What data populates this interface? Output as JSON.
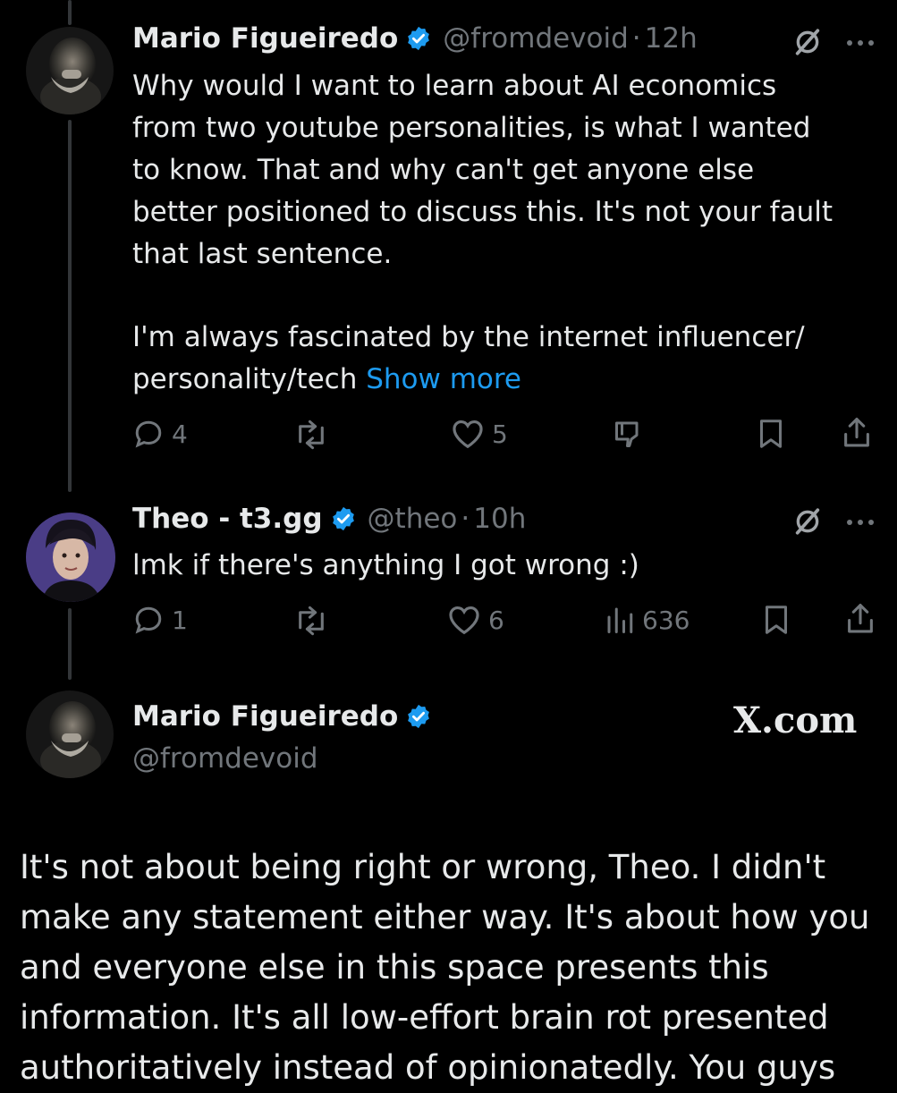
{
  "tweet1": {
    "name": "Mario Figueiredo",
    "handle": "@fromdevoid",
    "time": "12h",
    "text_main": "Why would I want to learn about AI economics\nfrom two youtube personalities, is what I wanted\nto know. That and why can't get anyone else\nbetter positioned to discuss this. It's not your fault\nthat last sentence.",
    "text_second": "I'm always fascinated by the internet influencer/\npersonality/tech ",
    "show_more": "Show more",
    "replies": "4",
    "likes": "5"
  },
  "tweet2": {
    "name": "Theo - t3.gg",
    "handle": "@theo",
    "time": "10h",
    "text": "lmk if there's anything I got wrong :)",
    "replies": "1",
    "likes": "6",
    "views": "636"
  },
  "quote": {
    "name": "Mario Figueiredo",
    "handle": "@fromdevoid",
    "brand": "X.com",
    "text": "It's not about being right or wrong, Theo. I didn't make any statement either way. It's about how you and everyone else in this space presents this information. It's all low-effort brain rot presented authoritatively instead of opinionatedly. You guys"
  },
  "colors": {
    "accent": "#1d9bf0",
    "muted": "#71767b",
    "text": "#e7e9ea",
    "background": "#000000"
  },
  "icons": [
    "grok-icon",
    "more-icon",
    "reply-icon",
    "retweet-icon",
    "like-icon",
    "dislike-icon",
    "bookmark-icon",
    "share-icon",
    "views-icon",
    "verified-icon"
  ]
}
